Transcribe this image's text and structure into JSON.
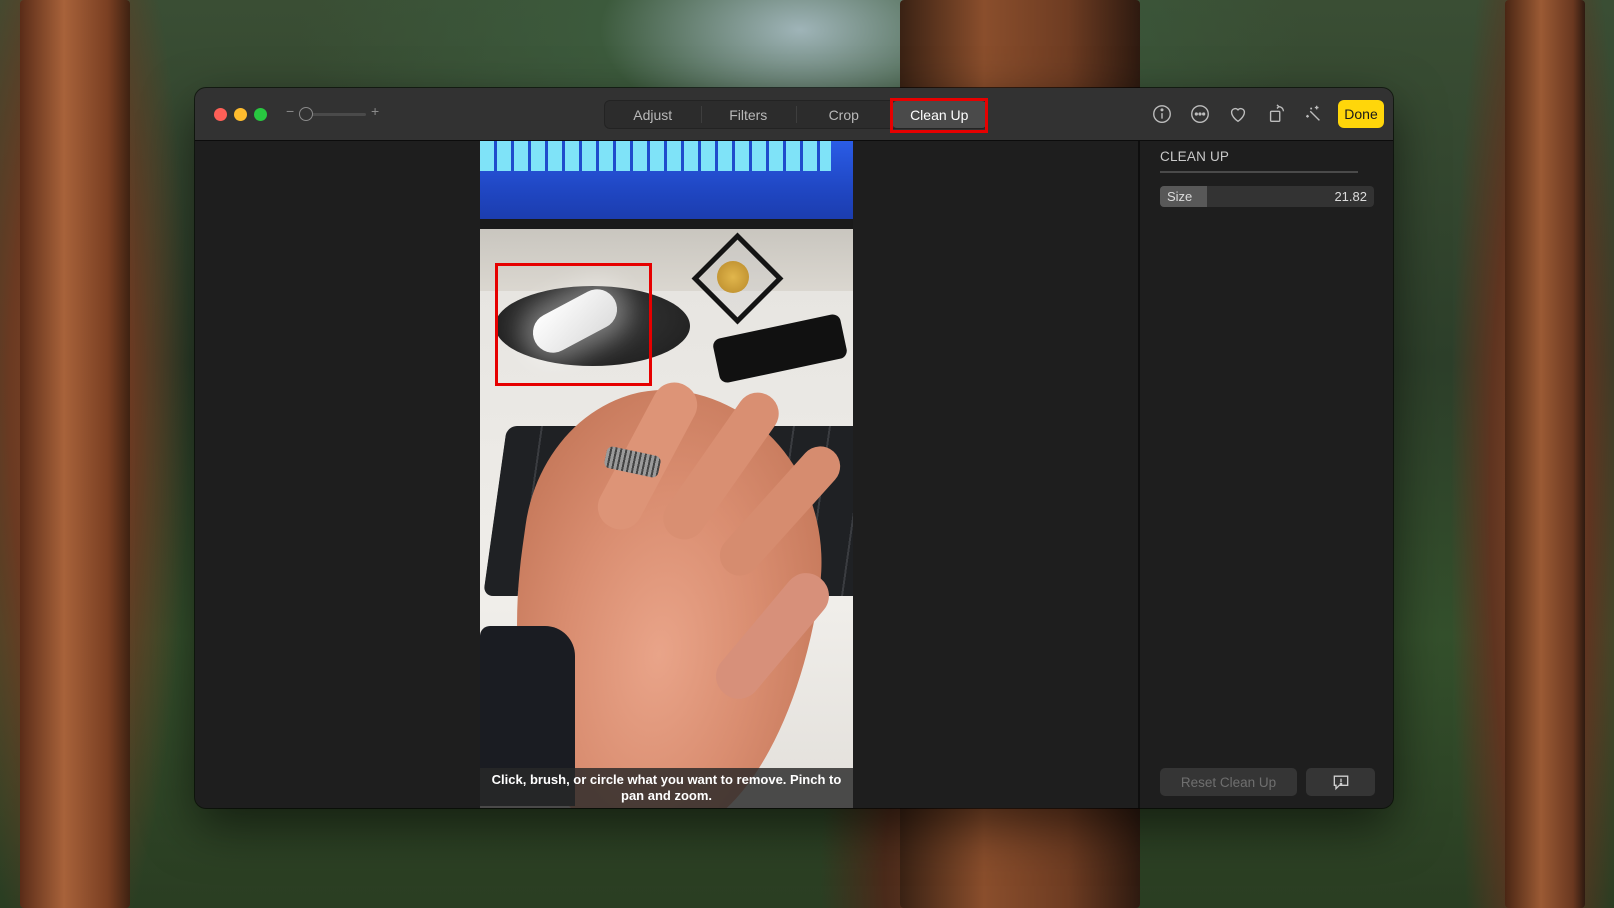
{
  "background": {
    "description": "Redwood forest desktop wallpaper"
  },
  "window": {
    "traffic_lights": {
      "close": "#fe5f57",
      "minimize": "#febc2e",
      "maximize": "#28c840"
    },
    "zoom_slider": {
      "minus_label": "−",
      "plus_label": "+",
      "value_fraction": 0.0
    },
    "tabs": [
      {
        "label": "Adjust",
        "active": false
      },
      {
        "label": "Filters",
        "active": false
      },
      {
        "label": "Crop",
        "active": false
      },
      {
        "label": "Clean Up",
        "active": true
      }
    ],
    "toolbar_icons": [
      {
        "name": "info-icon"
      },
      {
        "name": "more-icon"
      },
      {
        "name": "favorite-heart-icon"
      },
      {
        "name": "rotate-icon"
      },
      {
        "name": "auto-enhance-icon"
      }
    ],
    "done_label": "Done",
    "accent_color": "#ffd60a",
    "highlight_color": "#e60000"
  },
  "photo": {
    "hint_text": "Click, brush, or circle what you want to remove. Pinch to pan and zoom."
  },
  "sidebar": {
    "title": "CLEAN UP",
    "size": {
      "label": "Size",
      "value": "21.82",
      "fill_fraction": 0.22
    },
    "reset_label": "Reset Clean Up",
    "feedback_icon": "feedback-icon"
  }
}
